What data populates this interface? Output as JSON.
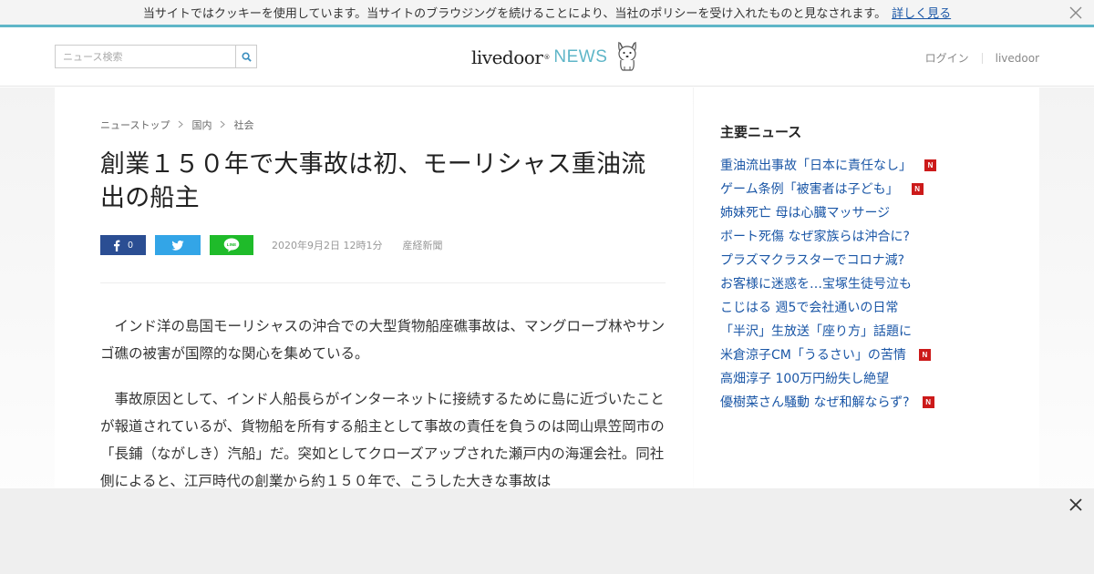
{
  "cookie": {
    "message": "当サイトではクッキーを使用しています。当サイトのブラウジングを続けることにより、当社のポリシーを受け入れたものと見なされます。",
    "link": "詳しく見る"
  },
  "header": {
    "search_placeholder": "ニュース検索",
    "logo_brand": "livedoor",
    "logo_mark": "®",
    "logo_news": "NEWS",
    "login": "ログイン",
    "livedoor": "livedoor"
  },
  "colors": {
    "accent": "#5fb6c8",
    "link": "#1a56a6",
    "facebook": "#2b4e93",
    "twitter": "#33a5e7",
    "line": "#1fbb2a",
    "new_badge": "#cc1a1a"
  },
  "article": {
    "breadcrumb": [
      "ニューストップ",
      "国内",
      "社会"
    ],
    "title": "創業１５０年で大事故は初、モーリシャス重油流出の船主",
    "share": {
      "facebook_count": "0",
      "line_label": "LINE"
    },
    "date": "2020年9月2日 12時1分",
    "source": "産経新聞",
    "paragraphs": [
      "インド洋の島国モーリシャスの沖合での大型貨物船座礁事故は、マングローブ林やサンゴ礁の被害が国際的な関心を集めている。",
      "事故原因として、インド人船長らがインターネットに接続するために島に近づいたことが報道されているが、貨物船を所有する船主として事故の責任を負うのは岡山県笠岡市の「長鋪（ながしき）汽船」だ。突如としてクローズアップされた瀬戸内の海運会社。同社側によると、江戸時代の創業から約１５０年で、こうした大きな事故は"
    ]
  },
  "sidebar": {
    "title": "主要ニュース",
    "items": [
      {
        "label": "重油流出事故「日本に責任なし」",
        "new": true
      },
      {
        "label": "ゲーム条例「被害者は子ども」",
        "new": true
      },
      {
        "label": "姉妹死亡 母は心臓マッサージ",
        "new": false
      },
      {
        "label": "ボート死傷 なぜ家族らは沖合に?",
        "new": false
      },
      {
        "label": "プラズマクラスターでコロナ減?",
        "new": false
      },
      {
        "label": "お客様に迷惑を…宝塚生徒号泣も",
        "new": false
      },
      {
        "label": "こじはる 週5で会社通いの日常",
        "new": false
      },
      {
        "label": "「半沢」生放送「座り方」話題に",
        "new": false
      },
      {
        "label": "米倉涼子CM「うるさい」の苦情",
        "new": true
      },
      {
        "label": "高畑淳子 100万円紛失し絶望",
        "new": false
      },
      {
        "label": "優樹菜さん騒動 なぜ和解ならず?",
        "new": true
      }
    ],
    "new_badge": "N"
  },
  "icons": {
    "search": "search-icon",
    "close": "close-icon",
    "facebook": "facebook-icon",
    "twitter": "twitter-icon",
    "line": "line-icon",
    "dog": "dog-mascot-icon"
  }
}
